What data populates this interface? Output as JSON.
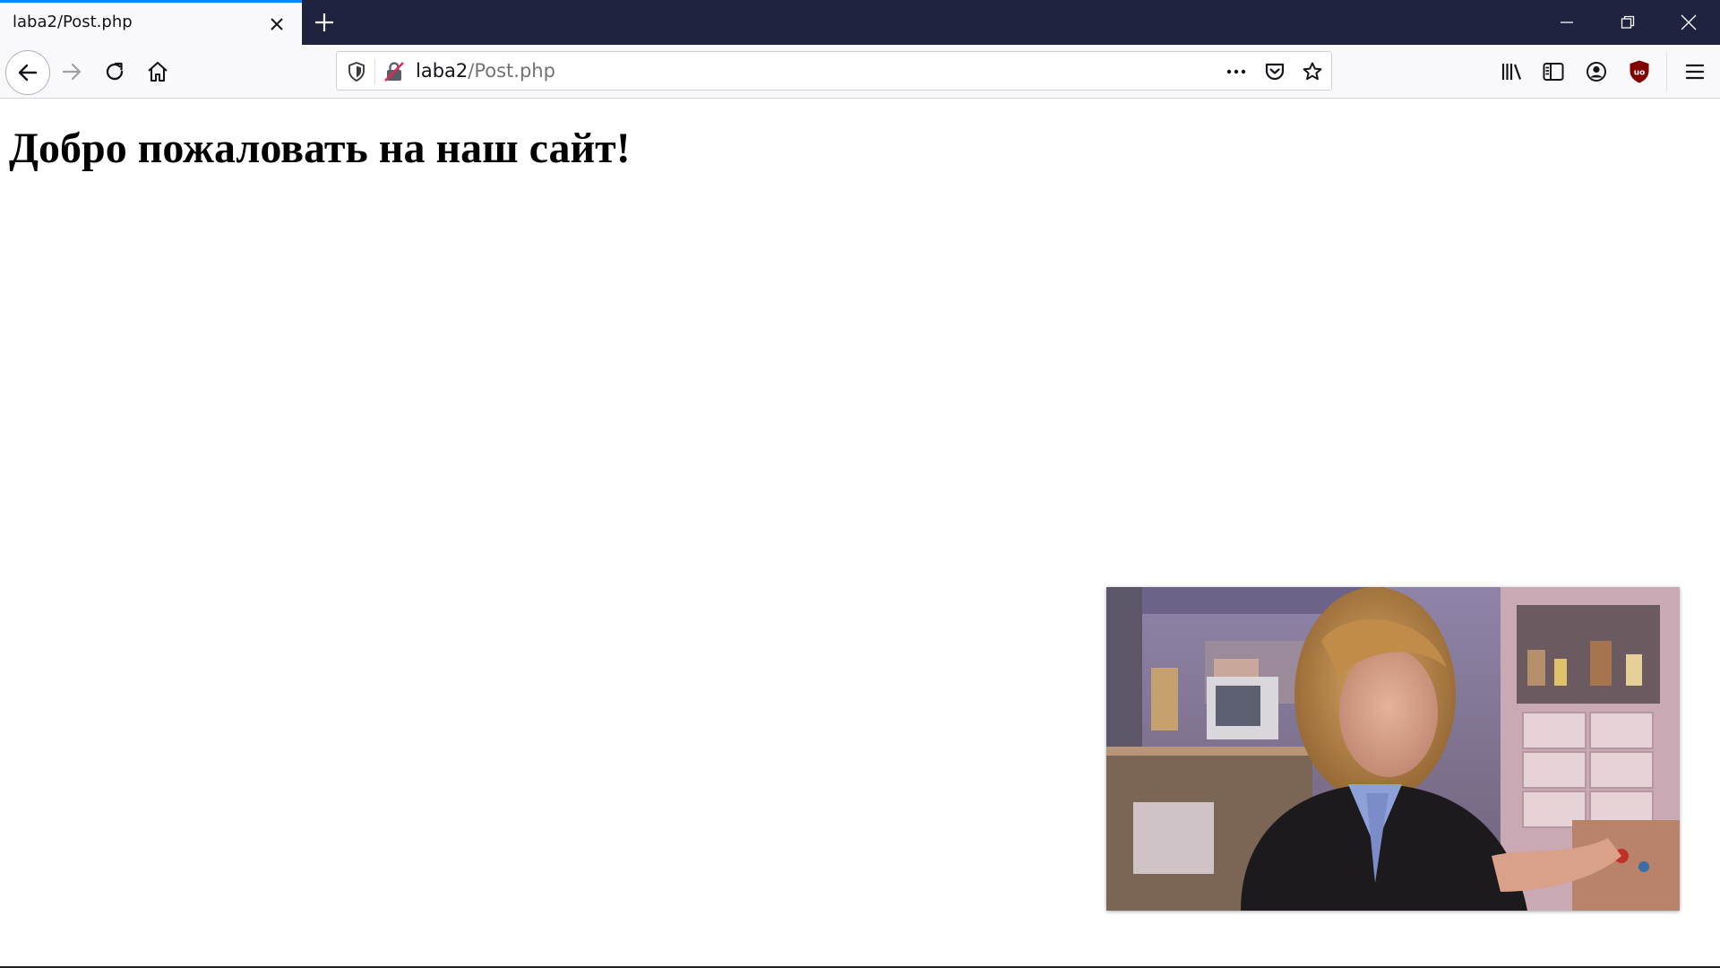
{
  "browser": {
    "tab": {
      "title": "laba2/Post.php"
    },
    "url": {
      "host": "laba2",
      "path": "/Post.php"
    },
    "colors": {
      "tabstrip": "#202340",
      "active_tab_accent": "#0a84ff",
      "ublock_red": "#800000"
    },
    "icons": {
      "tab_close": "close-icon",
      "new_tab": "plus-icon",
      "back": "arrow-left-icon",
      "forward": "arrow-right-icon",
      "reload": "reload-icon",
      "home": "home-icon",
      "tracking": "shield-icon",
      "insecure": "insecure-lock-icon",
      "page_actions": "more-icon",
      "pocket": "pocket-icon",
      "bookmark": "star-icon",
      "library": "library-icon",
      "sidebars": "sidebar-icon",
      "account": "account-icon",
      "ublock": "ublock-icon",
      "menu": "hamburger-icon",
      "minimize": "minimize-icon",
      "restore": "restore-icon",
      "close_window": "close-window-icon"
    }
  },
  "page": {
    "heading": "Добро пожаловать на наш сайт!"
  }
}
